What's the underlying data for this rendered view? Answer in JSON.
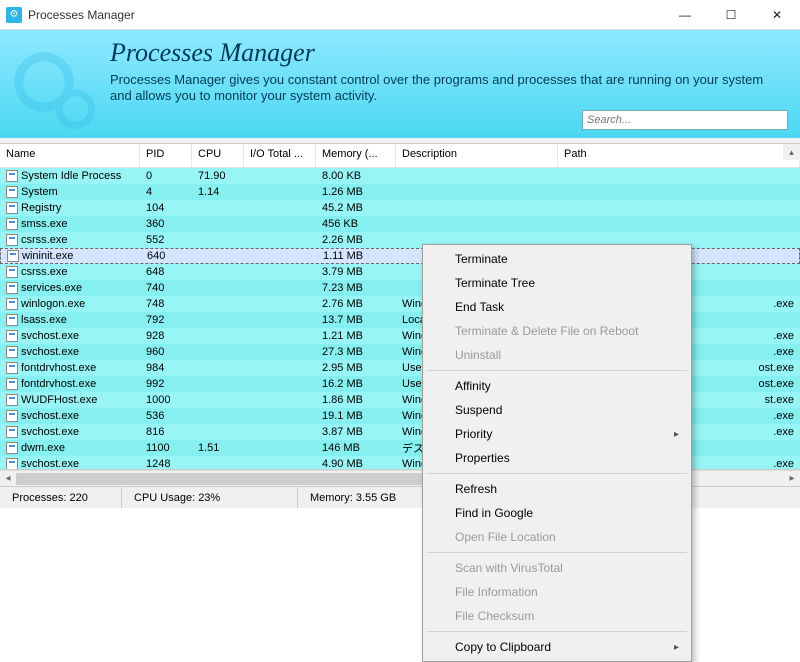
{
  "window": {
    "title": "Processes Manager"
  },
  "banner": {
    "heading": "Processes Manager",
    "subtext": "Processes Manager gives you constant control over the programs and processes that are running on your system and allows you to monitor your system activity.",
    "search_placeholder": "Search..."
  },
  "columns": {
    "name": "Name",
    "pid": "PID",
    "cpu": "CPU",
    "io": "I/O Total ...",
    "mem": "Memory (...",
    "desc": "Description",
    "path": "Path"
  },
  "rows": [
    {
      "name": "System Idle Process",
      "pid": "0",
      "cpu": "71.90",
      "io": "",
      "mem": "8.00 KB",
      "desc": "",
      "path": ""
    },
    {
      "name": "System",
      "pid": "4",
      "cpu": "1.14",
      "io": "",
      "mem": "1.26 MB",
      "desc": "",
      "path": ""
    },
    {
      "name": "Registry",
      "pid": "104",
      "cpu": "",
      "io": "",
      "mem": "45.2 MB",
      "desc": "",
      "path": ""
    },
    {
      "name": "smss.exe",
      "pid": "360",
      "cpu": "",
      "io": "",
      "mem": "456 KB",
      "desc": "",
      "path": ""
    },
    {
      "name": "csrss.exe",
      "pid": "552",
      "cpu": "",
      "io": "",
      "mem": "2.26 MB",
      "desc": "",
      "path": ""
    },
    {
      "name": "wininit.exe",
      "pid": "640",
      "cpu": "",
      "io": "",
      "mem": "1.11 MB",
      "desc": "",
      "path": "",
      "selected": true
    },
    {
      "name": "csrss.exe",
      "pid": "648",
      "cpu": "",
      "io": "",
      "mem": "3.79 MB",
      "desc": "",
      "path": ""
    },
    {
      "name": "services.exe",
      "pid": "740",
      "cpu": "",
      "io": "",
      "mem": "7.23 MB",
      "desc": "",
      "path": ""
    },
    {
      "name": "winlogon.exe",
      "pid": "748",
      "cpu": "",
      "io": "",
      "mem": "2.76 MB",
      "desc": "Wind",
      "path": ".exe"
    },
    {
      "name": "lsass.exe",
      "pid": "792",
      "cpu": "",
      "io": "",
      "mem": "13.7 MB",
      "desc": "Loca",
      "path": ""
    },
    {
      "name": "svchost.exe",
      "pid": "928",
      "cpu": "",
      "io": "",
      "mem": "1.21 MB",
      "desc": "Wind",
      "path": ".exe"
    },
    {
      "name": "svchost.exe",
      "pid": "960",
      "cpu": "",
      "io": "",
      "mem": "27.3 MB",
      "desc": "Wind",
      "path": ".exe"
    },
    {
      "name": "fontdrvhost.exe",
      "pid": "984",
      "cpu": "",
      "io": "",
      "mem": "2.95 MB",
      "desc": "User",
      "path": "ost.exe"
    },
    {
      "name": "fontdrvhost.exe",
      "pid": "992",
      "cpu": "",
      "io": "",
      "mem": "16.2 MB",
      "desc": "User",
      "path": "ost.exe"
    },
    {
      "name": "WUDFHost.exe",
      "pid": "1000",
      "cpu": "",
      "io": "",
      "mem": "1.86 MB",
      "desc": "Wind",
      "path": "st.exe"
    },
    {
      "name": "svchost.exe",
      "pid": "536",
      "cpu": "",
      "io": "",
      "mem": "19.1 MB",
      "desc": "Wind",
      "path": ".exe"
    },
    {
      "name": "svchost.exe",
      "pid": "816",
      "cpu": "",
      "io": "",
      "mem": "3.87 MB",
      "desc": "Wind",
      "path": ".exe"
    },
    {
      "name": "dwm.exe",
      "pid": "1100",
      "cpu": "1.51",
      "io": "",
      "mem": "146 MB",
      "desc": "デス",
      "path": ""
    },
    {
      "name": "svchost.exe",
      "pid": "1248",
      "cpu": "",
      "io": "",
      "mem": "4.90 MB",
      "desc": "Wind",
      "path": ".exe"
    }
  ],
  "statusbar": {
    "processes": "Processes: 220",
    "cpu": "CPU Usage: 23%",
    "memory": "Memory: 3.55 GB"
  },
  "context_menu": [
    {
      "label": "Terminate",
      "type": "item"
    },
    {
      "label": "Terminate Tree",
      "type": "item"
    },
    {
      "label": "End Task",
      "type": "item"
    },
    {
      "label": "Terminate & Delete File on Reboot",
      "type": "item",
      "disabled": true
    },
    {
      "label": "Uninstall",
      "type": "item",
      "disabled": true
    },
    {
      "type": "sep"
    },
    {
      "label": "Affinity",
      "type": "item"
    },
    {
      "label": "Suspend",
      "type": "item"
    },
    {
      "label": "Priority",
      "type": "item",
      "submenu": true
    },
    {
      "label": "Properties",
      "type": "item"
    },
    {
      "type": "sep"
    },
    {
      "label": "Refresh",
      "type": "item"
    },
    {
      "label": "Find in Google",
      "type": "item"
    },
    {
      "label": "Open File Location",
      "type": "item",
      "disabled": true
    },
    {
      "type": "sep"
    },
    {
      "label": "Scan with VirusTotal",
      "type": "item",
      "disabled": true
    },
    {
      "label": "File Information",
      "type": "item",
      "disabled": true
    },
    {
      "label": "File Checksum",
      "type": "item",
      "disabled": true
    },
    {
      "type": "sep"
    },
    {
      "label": "Copy to Clipboard",
      "type": "item",
      "submenu": true
    }
  ]
}
